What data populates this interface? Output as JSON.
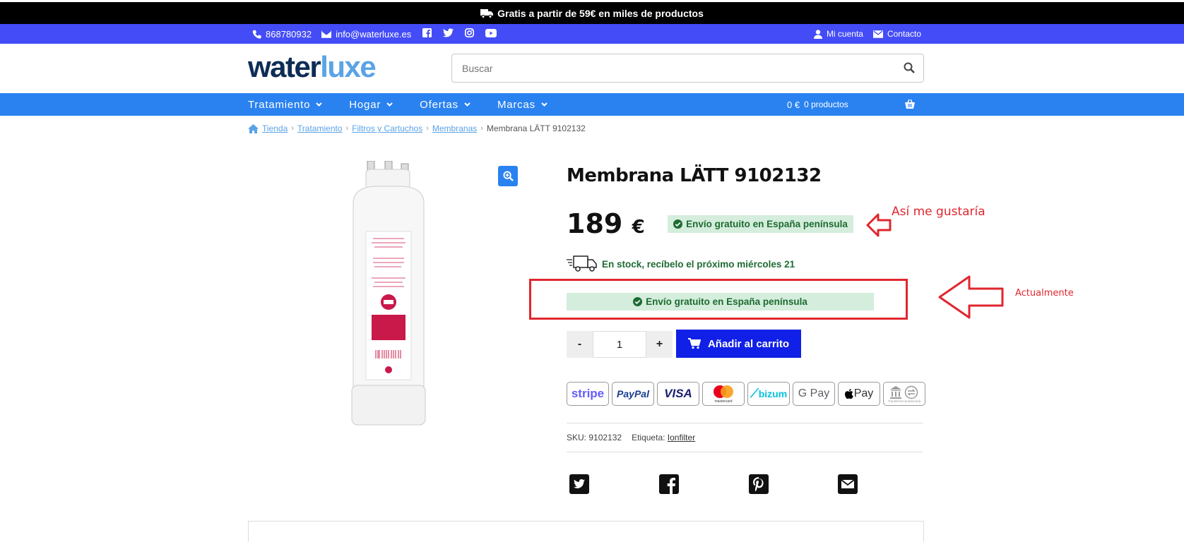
{
  "promo": {
    "text": "Gratis a partir de 59€ en miles de productos"
  },
  "infobar": {
    "phone": "868780932",
    "email": "info@waterluxe.es",
    "account": "Mi cuenta",
    "contact": "Contacto"
  },
  "logo": {
    "part1": "water",
    "part2": "luxe"
  },
  "search": {
    "placeholder": "Buscar"
  },
  "nav": {
    "items": [
      {
        "label": "Tratamiento"
      },
      {
        "label": "Hogar"
      },
      {
        "label": "Ofertas"
      },
      {
        "label": "Marcas"
      }
    ],
    "cart_total": "0 €",
    "cart_count": "0 productos"
  },
  "breadcrumb": {
    "items": [
      "Tienda",
      "Tratamiento",
      "Filtros y Cartuchos",
      "Membranas"
    ],
    "current": "Membrana LÄTT 9102132"
  },
  "product": {
    "title": "Membrana LÄTT 9102132",
    "price": "189",
    "currency": "€",
    "shipping": "Envío gratuito en España península",
    "stock": "En stock, recíbelo el próximo miércoles 21",
    "quantity": "1",
    "qty_minus": "-",
    "qty_plus": "+",
    "add_to_cart": "Añadir al carrito",
    "sku_label": "SKU:",
    "sku": "9102132",
    "tag_label": "Etiqueta:",
    "tag": "Ionfilter"
  },
  "payments": [
    "stripe",
    "PayPal",
    "VISA",
    "mastercard",
    "bizum",
    "G Pay",
    "Pay",
    "Transferencia Bancaria"
  ],
  "annotations": {
    "desired": "Así me gustaría",
    "current": "Actualmente"
  },
  "colors": {
    "promo_bg": "#000000",
    "infobar_bg": "#444cf7",
    "nav_bg": "#2a82f0",
    "add_to_cart_bg": "#1020e6",
    "shipping_badge_bg": "#d4eddc",
    "annotation_red": "#e0262e"
  }
}
